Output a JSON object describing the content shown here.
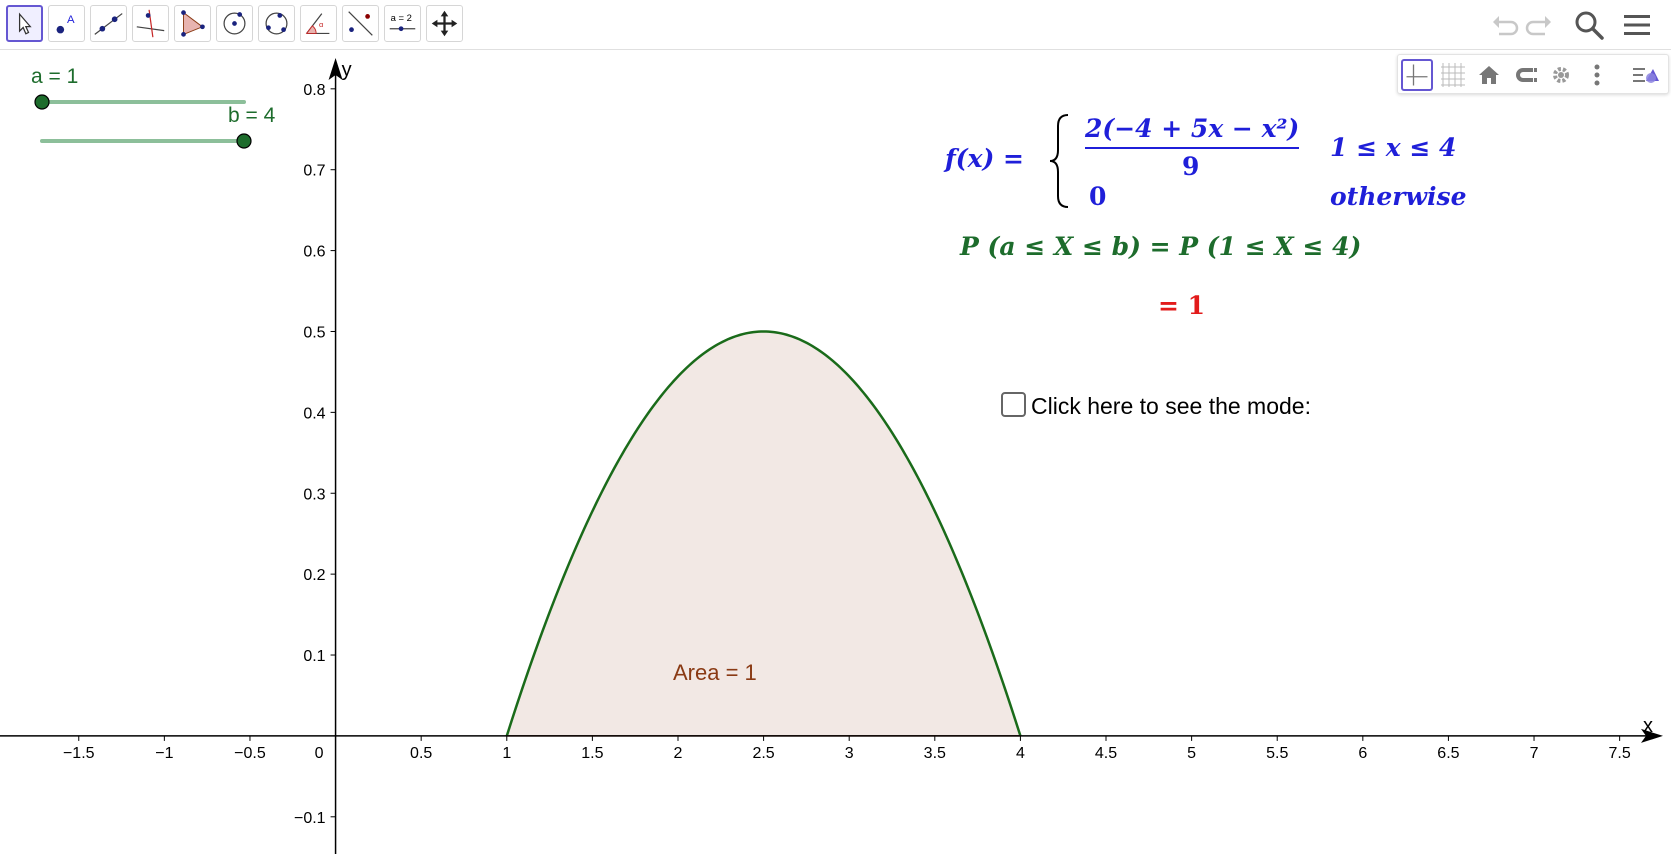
{
  "toolbar": {
    "tools": [
      {
        "name": "move-tool",
        "active": true
      },
      {
        "name": "point-tool"
      },
      {
        "name": "line-tool"
      },
      {
        "name": "perpendicular-tool"
      },
      {
        "name": "polygon-tool"
      },
      {
        "name": "circle-center-tool"
      },
      {
        "name": "circle-three-points-tool"
      },
      {
        "name": "angle-tool"
      },
      {
        "name": "reflect-tool"
      },
      {
        "name": "slider-tool",
        "label": "a = 2"
      },
      {
        "name": "move-graphics-view-tool"
      }
    ],
    "right_icons": [
      "undo-icon",
      "redo-icon",
      "search-icon",
      "menu-icon"
    ]
  },
  "style_bar": {
    "buttons": [
      "axes-icon",
      "grid-icon",
      "home-icon",
      "magnet-icon",
      "settings-icon",
      "more-icon",
      "toggle-style-bar-icon"
    ]
  },
  "sliders": {
    "a": {
      "label": "a = 1",
      "value": 1
    },
    "b": {
      "label": "b = 4",
      "value": 4
    }
  },
  "formula": {
    "f_lhs": "f(x) =",
    "case1_numerator": "2(−4 + 5x − x²)",
    "case1_denominator": "9",
    "case1_condition": "1 ≤ x ≤ 4",
    "case2_value": "0",
    "case2_condition": "otherwise",
    "probability": "P (a ≤ X ≤ b) = P (1 ≤ X ≤ 4)",
    "result": "= 1"
  },
  "checkbox": {
    "label": "Click here to see the mode:",
    "checked": false
  },
  "area_label": "Area = 1",
  "axes": {
    "x_label": "x",
    "y_label": "y",
    "x_ticks": [
      "−1.5",
      "−1",
      "−0.5",
      "0",
      "0.5",
      "1",
      "1.5",
      "2",
      "2.5",
      "3",
      "3.5",
      "4",
      "4.5",
      "5",
      "5.5",
      "6",
      "6.5",
      "7",
      "7.5"
    ],
    "y_ticks": [
      "0.8",
      "0.7",
      "0.6",
      "0.5",
      "0.4",
      "0.3",
      "0.2",
      "0.1",
      "−0.1"
    ]
  },
  "chart_data": {
    "type": "area",
    "function": "2(-4+5x-x^2)/9",
    "domain": [
      1,
      4
    ],
    "shaded_interval": [
      1,
      4
    ],
    "xlim": [
      -1.96,
      7.8
    ],
    "ylim": [
      -0.146,
      0.848
    ],
    "colors": {
      "curve": "#1a6b1a",
      "fill": "#f2e8e4",
      "area_label": "#8a3a14"
    }
  },
  "colors": {
    "accent": "#6557d2",
    "slider": "#1d6c2c",
    "formula_blue": "#1f1fd9",
    "formula_green": "#1d6c2c",
    "formula_red": "#e21b1b"
  }
}
